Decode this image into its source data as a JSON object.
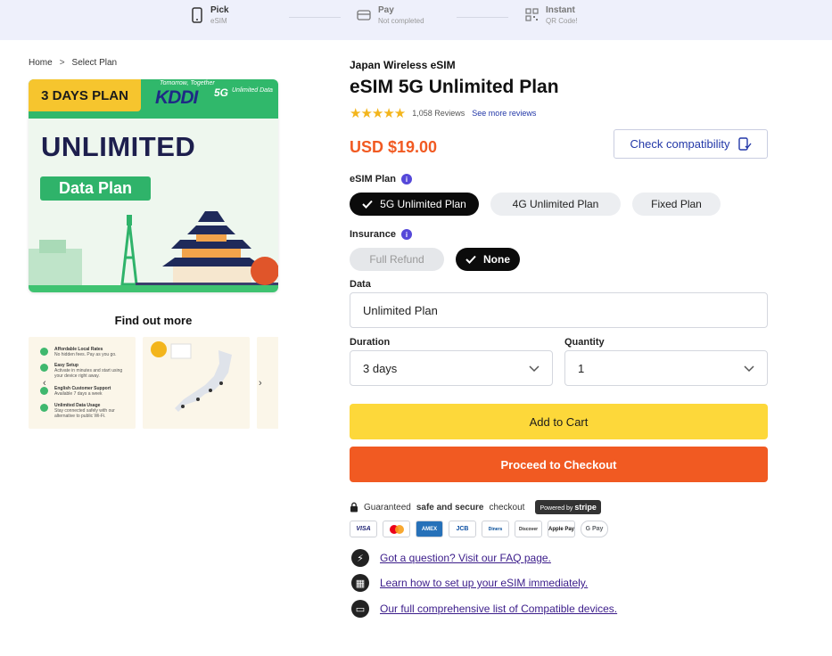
{
  "stepper": {
    "steps": [
      {
        "title": "Pick",
        "sub": "eSIM"
      },
      {
        "title": "Pay",
        "sub": "Not completed"
      },
      {
        "title": "Instant",
        "sub": "QR Code!"
      }
    ]
  },
  "breadcrumb": {
    "home": "Home",
    "sep": ">",
    "current": "Select Plan"
  },
  "hero": {
    "badge": "3 DAYS PLAN",
    "tagline": "Tomorrow, Together",
    "carrier": "KDDI",
    "network": "5G",
    "network_sub": "Unlimited Data",
    "headline": "UNLIMITED",
    "subheadline": "Data Plan"
  },
  "gallery": {
    "heading": "Find out more",
    "thumb1": [
      {
        "title": "Affordable Local Rates",
        "text": "No hidden fees. Pay as you go."
      },
      {
        "title": "Easy Setup",
        "text": "Activate in minutes and start using your device right away."
      },
      {
        "title": "English Customer Support",
        "text": "Available 7 days a week"
      },
      {
        "title": "Unlimited Data Usage",
        "text": "Stay connected safely with our alternative to public Wi-Fi."
      }
    ]
  },
  "product": {
    "brand": "Japan Wireless eSIM",
    "title": "eSIM 5G Unlimited Plan",
    "rating": 4.5,
    "stars": "★★★★★",
    "reviews": "1,058 Reviews",
    "more_reviews": "See more reviews",
    "price": "USD $19.00",
    "check_compat": "Check compatibility"
  },
  "options": {
    "esim_plan_label": "eSIM Plan",
    "plans": [
      "5G Unlimited Plan",
      "4G Unlimited Plan",
      "Fixed Plan"
    ],
    "insurance_label": "Insurance",
    "insurance": [
      "Full Refund",
      "None"
    ],
    "data_label": "Data",
    "data_value": "Unlimited Plan",
    "duration_label": "Duration",
    "duration_value": "3 days",
    "quantity_label": "Quantity",
    "quantity_value": "1"
  },
  "actions": {
    "add_to_cart": "Add to Cart",
    "checkout": "Proceed to Checkout"
  },
  "secure": {
    "prefix": "Guaranteed",
    "bold": "safe and secure",
    "suffix": "checkout",
    "powered": "Powered by",
    "stripe": "stripe"
  },
  "payments": [
    "VISA",
    "MC",
    "AMEX",
    "JCB",
    "Diners",
    "Discover",
    "Apple Pay",
    "G Pay"
  ],
  "links": [
    {
      "icon": "lightning-icon",
      "text": "Got a question? Visit our FAQ page."
    },
    {
      "icon": "qr-icon",
      "text": "Learn how to set up your eSIM immediately."
    },
    {
      "icon": "device-icon",
      "text": "Our full comprehensive list of Compatible devices."
    }
  ],
  "colors": {
    "accent": "#f15a22",
    "yellow": "#fdd83a",
    "link": "#2338a8"
  }
}
